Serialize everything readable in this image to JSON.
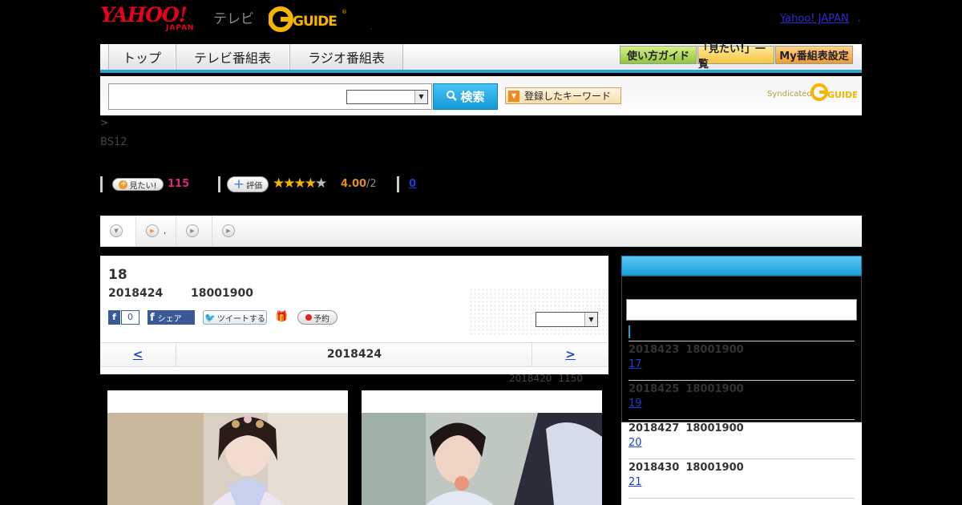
{
  "header": {
    "logo_yahoo": "YAHOO!",
    "logo_japan": "JAPAN",
    "logo_tv": "テレビ",
    "logo_gguide": "G-GUIDE",
    "link_yahoo_japan": "Yahoo! JAPAN",
    "link_sep": ",",
    "tiny_dot": ","
  },
  "nav": {
    "tabs": [
      "トップ",
      "テレビ番組表",
      "ラジオ番組表"
    ],
    "buttons": [
      "使い方ガイド",
      "「見たい!」一覧",
      "My番組表設定"
    ]
  },
  "search": {
    "input_value": "",
    "select_value": "",
    "button_label": "検索",
    "keyword_button": "登録したキーワード",
    "syndicated": "Syndicated"
  },
  "breadcrumb": ">",
  "channel": "BS12",
  "actions": {
    "mitai_label": "見たい!",
    "mitai_count": "115",
    "hyoka_label": "評価",
    "stars_on": "★★★★",
    "stars_off": "★",
    "score": "4.00",
    "score_count": "/2",
    "comments": "0"
  },
  "content_tabs": {
    "tab2_text": ","
  },
  "program": {
    "title": "18",
    "date": "2018424",
    "time": "18001900",
    "fb_like_count": "0",
    "fb_share": "シェア",
    "tweet": "ツイートする",
    "reserve": "予約",
    "select_value": "",
    "prev": "<",
    "nav_date": "2018424",
    "next": ">",
    "updated_date": "2018420",
    "updated_time": "1150"
  },
  "sidebar": {
    "input_value": "",
    "episodes": [
      {
        "date": "2018423",
        "time": "18001900",
        "link": "17"
      },
      {
        "date": "2018425",
        "time": "18001900",
        "link": "19"
      },
      {
        "date": "2018427",
        "time": "18001900",
        "link": "20"
      },
      {
        "date": "2018430",
        "time": "18001900",
        "link": "21"
      }
    ]
  },
  "colors": {
    "accent_blue": "#27a0d8",
    "yahoo_red": "#e8001c",
    "rating_orange": "#e88c1c",
    "mitai_pink": "#e0257a"
  }
}
